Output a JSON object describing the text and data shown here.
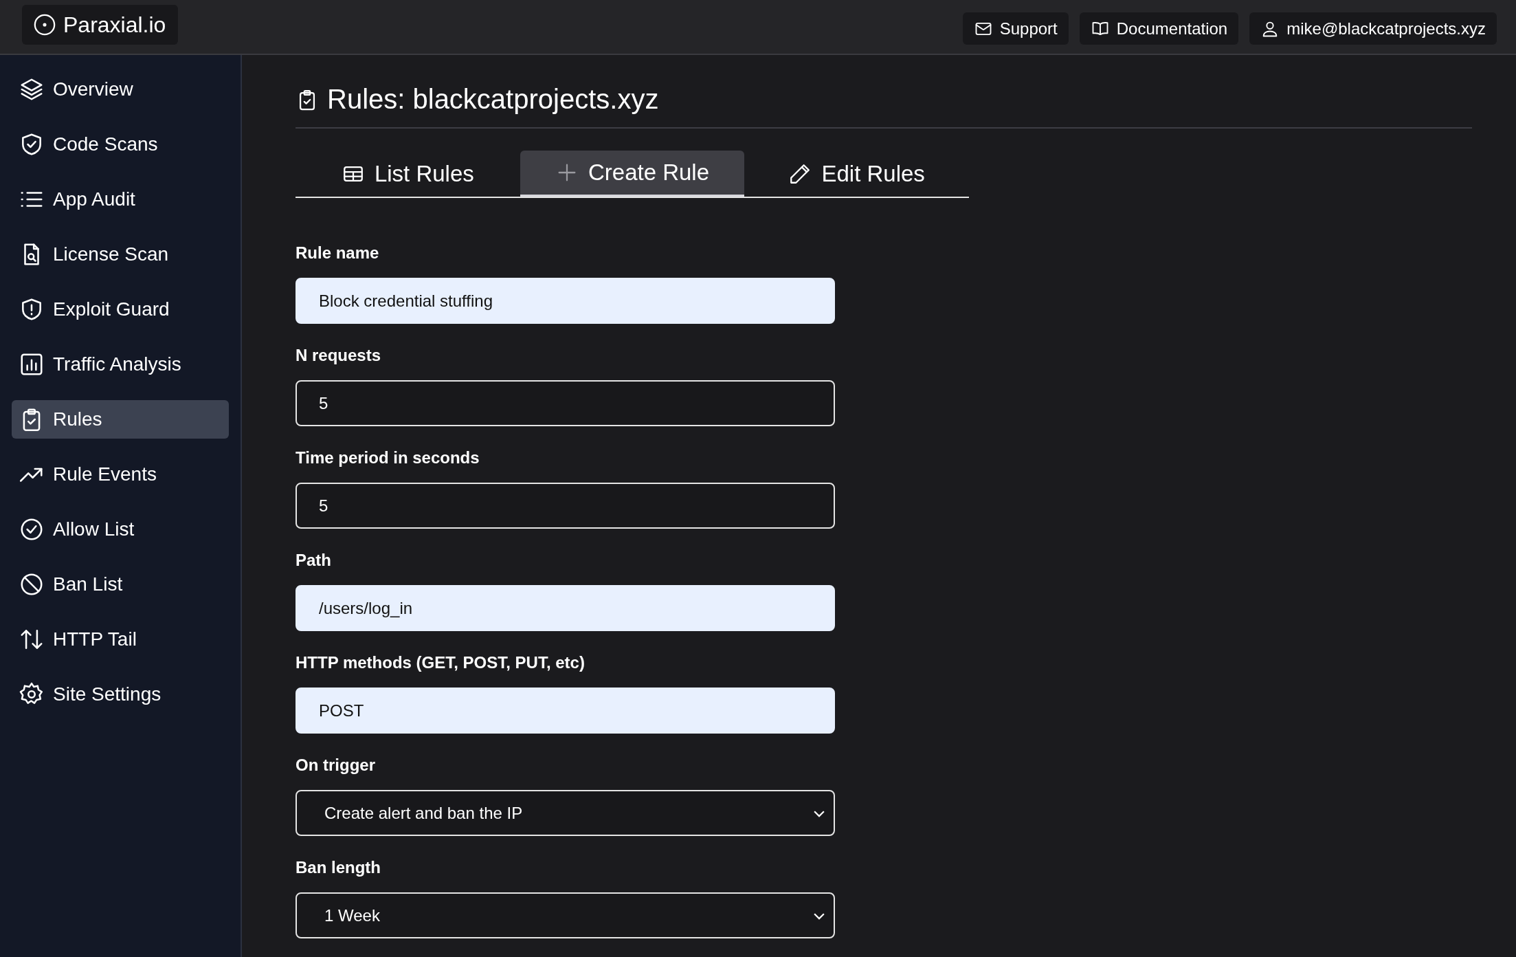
{
  "topbar": {
    "logo": "Paraxial.io",
    "links": [
      {
        "label": "Support"
      },
      {
        "label": "Documentation"
      },
      {
        "label": "mike@blackcatprojects.xyz"
      }
    ]
  },
  "sidebar": {
    "items": [
      {
        "label": "Overview",
        "selected": false
      },
      {
        "label": "Code Scans",
        "selected": false
      },
      {
        "label": "App Audit",
        "selected": false
      },
      {
        "label": "License Scan",
        "selected": false
      },
      {
        "label": "Exploit Guard",
        "selected": false
      },
      {
        "label": "Traffic Analysis",
        "selected": false
      },
      {
        "label": "Rules",
        "selected": true
      },
      {
        "label": "Rule Events",
        "selected": false
      },
      {
        "label": "Allow List",
        "selected": false
      },
      {
        "label": "Ban List",
        "selected": false
      },
      {
        "label": "HTTP Tail",
        "selected": false
      },
      {
        "label": "Site Settings",
        "selected": false
      }
    ]
  },
  "page": {
    "title": "Rules: blackcatprojects.xyz"
  },
  "tabs": [
    {
      "label": "List Rules",
      "selected": false
    },
    {
      "label": "Create Rule",
      "selected": true
    },
    {
      "label": "Edit Rules",
      "selected": false
    }
  ],
  "form": {
    "fields": [
      {
        "kind": "text",
        "label": "Rule name",
        "value": "Block credential stuffing",
        "autofilled": true
      },
      {
        "kind": "text",
        "label": "N requests",
        "value": "5",
        "autofilled": false
      },
      {
        "kind": "text",
        "label": "Time period in seconds",
        "value": "5",
        "autofilled": false
      },
      {
        "kind": "text",
        "label": "Path",
        "value": "/users/log_in",
        "autofilled": true
      },
      {
        "kind": "text",
        "label": "HTTP methods (GET, POST, PUT, etc)",
        "value": "POST",
        "autofilled": true
      },
      {
        "kind": "select",
        "label": "On trigger",
        "value": "Create alert and ban the IP",
        "autofilled": false
      },
      {
        "kind": "select",
        "label": "Ban length",
        "value": "1 Week",
        "autofilled": false
      }
    ]
  }
}
